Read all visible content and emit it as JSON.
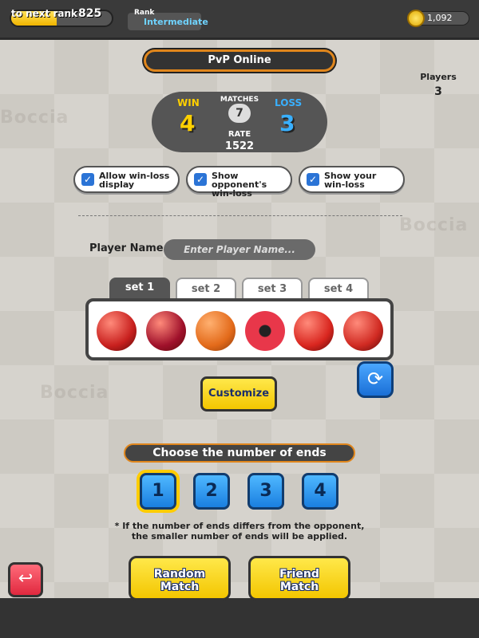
{
  "topbar": {
    "rank_label": "to next rank",
    "rank_points": "825",
    "rank_progress": 0.45,
    "rank_title": "Rank",
    "rank_value": "Intermediate",
    "coins": "1,092"
  },
  "header": {
    "title": "PvP Online",
    "players_label": "Players",
    "players_value": "3"
  },
  "stats": {
    "win_label": "WIN",
    "win_value": "4",
    "matches_label": "MATCHES",
    "matches_value": "7",
    "loss_label": "LOSS",
    "loss_value": "3",
    "rate_label": "RATE",
    "rate_value": "1522"
  },
  "options": [
    {
      "label_line1": "Allow win-loss",
      "label_line2": "display",
      "checked": true
    },
    {
      "label_line1": "Show opponent's",
      "label_line2": "win-loss",
      "checked": true
    },
    {
      "label_line1": "Show your",
      "label_line2": "win-loss",
      "checked": true
    }
  ],
  "player": {
    "label": "Player Name",
    "placeholder": "Enter Player Name..."
  },
  "sets": {
    "tabs": [
      "set 1",
      "set 2",
      "set 3",
      "set 4"
    ],
    "selected": 0
  },
  "balls": [
    {
      "type": "red-ball-icon",
      "color": "#c8201e"
    },
    {
      "type": "dark-red-ball-icon",
      "color": "#a0112b"
    },
    {
      "type": "basketball-icon",
      "color": "#e36a1a"
    },
    {
      "type": "soccer-ball-icon",
      "color": "#e8374a"
    },
    {
      "type": "red-ball-icon",
      "color": "#d9261f"
    },
    {
      "type": "red-ball-icon",
      "color": "#d02a22"
    }
  ],
  "customize_label": "Customize",
  "ends": {
    "title": "Choose the number of ends",
    "options": [
      "1",
      "2",
      "3",
      "4"
    ],
    "selected": 0,
    "note_line1": "* If the number of ends differs from the opponent,",
    "note_line2": "the smaller number of ends will be applied."
  },
  "buttons": {
    "random_line1": "Random",
    "random_line2": "Match",
    "friend_line1": "Friend",
    "friend_line2": "Match"
  },
  "colors": {
    "accent": "#e0861c",
    "button_yellow": "#f3c600",
    "blue": "#1a7fe0"
  }
}
